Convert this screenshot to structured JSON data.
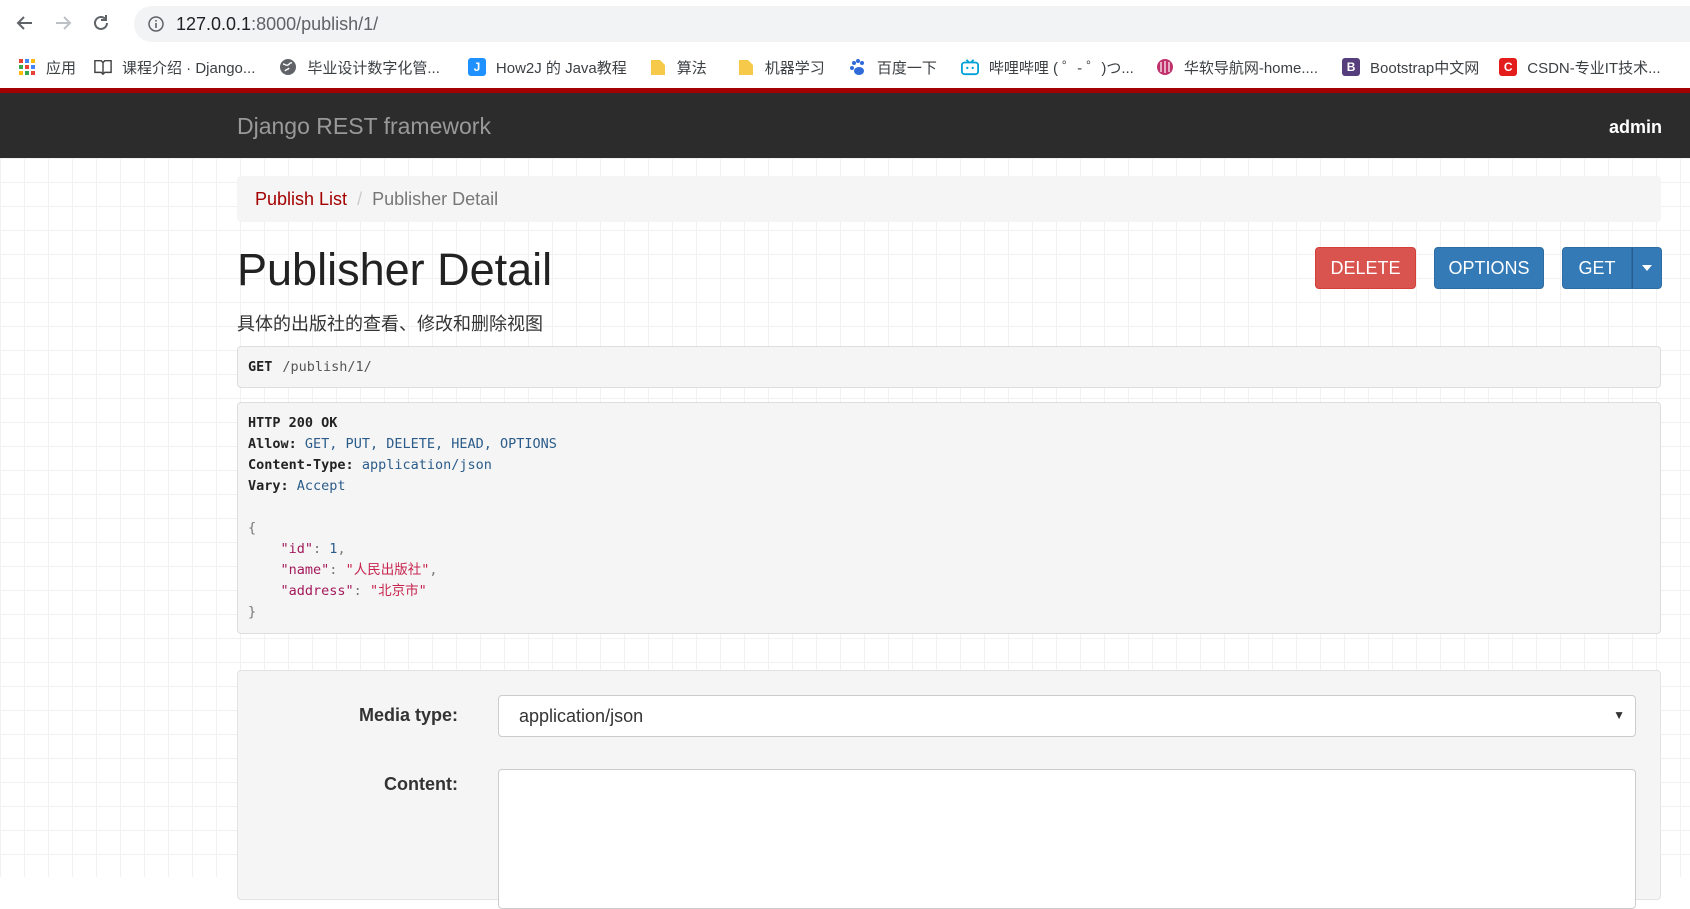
{
  "browser": {
    "url_host": "127.0.0.1",
    "url_rest": ":8000/publish/1/",
    "bookmarks": [
      {
        "label": "应用",
        "icon": "apps-grid-icon",
        "color": "#4285f4"
      },
      {
        "label": "课程介绍 · Django...",
        "icon": "book-icon",
        "color": "#555555"
      },
      {
        "label": "毕业设计数字化管...",
        "icon": "globe-icon",
        "color": "#555555"
      },
      {
        "label": "How2J 的 Java教程",
        "icon": "how2j-icon",
        "color": "#1e90ff"
      },
      {
        "label": "算法",
        "icon": "folder-icon",
        "color": "#f6c94b"
      },
      {
        "label": "机器学习",
        "icon": "folder-icon",
        "color": "#f6c94b"
      },
      {
        "label": "百度一下",
        "icon": "baidu-paw-icon",
        "color": "#2f6bd8"
      },
      {
        "label": "哔哩哔哩 ( ゜- ゜)つ...",
        "icon": "bilibili-tv-icon",
        "color": "#00a1d6"
      },
      {
        "label": "华软导航网-home....",
        "icon": "huaruan-logo-icon",
        "color": "#c0306a"
      },
      {
        "label": "Bootstrap中文网",
        "icon": "bootstrap-b-icon",
        "color": "#563d7c"
      },
      {
        "label": "CSDN-专业IT技术...",
        "icon": "csdn-c-icon",
        "color": "#e31c1c"
      }
    ]
  },
  "navbar": {
    "brand": "Django REST framework",
    "user": "admin"
  },
  "breadcrumb": {
    "parent": "Publish List",
    "sep": "/",
    "current": "Publisher Detail"
  },
  "page": {
    "title": "Publisher Detail",
    "description": "具体的出版社的查看、修改和删除视图"
  },
  "buttons": {
    "delete": "DELETE",
    "options": "OPTIONS",
    "get": "GET"
  },
  "request": {
    "method": "GET",
    "path": "/publish/1/"
  },
  "response": {
    "status": "HTTP 200 OK",
    "headers": [
      {
        "key": "Allow:",
        "value": "GET, PUT, DELETE, HEAD, OPTIONS"
      },
      {
        "key": "Content-Type:",
        "value": "application/json"
      },
      {
        "key": "Vary:",
        "value": "Accept"
      }
    ],
    "json": {
      "id_key": "\"id\"",
      "id_val": "1",
      "name_key": "\"name\"",
      "name_val": "\"人民出版社\"",
      "address_key": "\"address\"",
      "address_val": "\"北京市\""
    }
  },
  "form": {
    "media_type_label": "Media type:",
    "media_type_value": "application/json",
    "content_label": "Content:"
  },
  "colors": {
    "brand_red": "#a30000",
    "navbar_bg": "#2c2c2c",
    "delete": "#d9534f",
    "primary": "#337ab7"
  }
}
